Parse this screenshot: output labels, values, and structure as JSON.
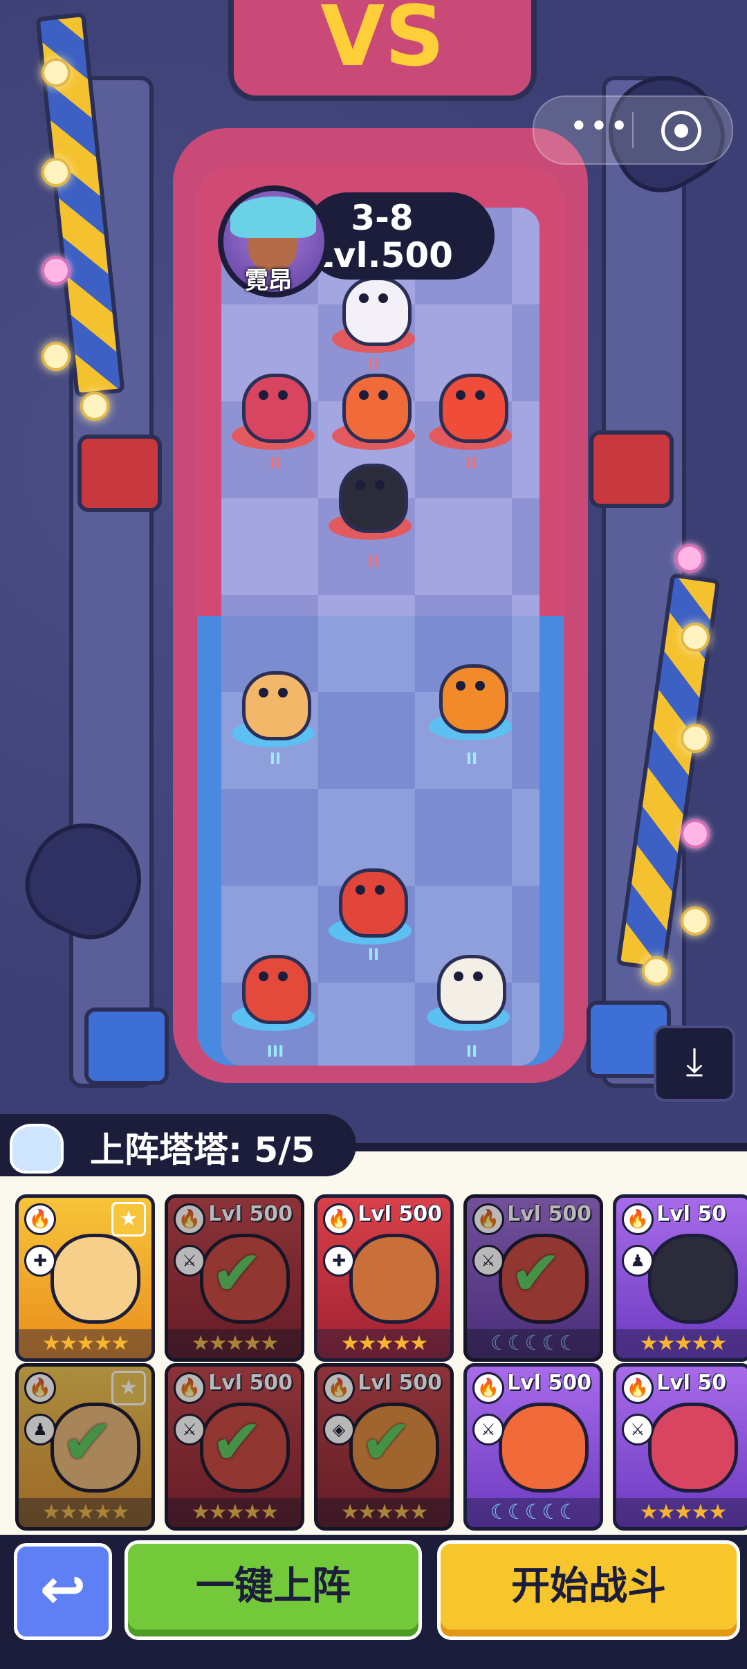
{
  "enemy": {
    "stage": "3-8",
    "level": "Lvl.500",
    "name": "霓昂"
  },
  "top_sign": {
    "text": "VS"
  },
  "enemy_units": [
    {
      "id": "enemy-1",
      "rank": "II",
      "color": "#f3f1f7"
    },
    {
      "id": "enemy-2",
      "rank": "II",
      "color": "#d94561"
    },
    {
      "id": "enemy-3",
      "rank": "II",
      "color": "#f06a3a"
    },
    {
      "id": "enemy-4",
      "rank": "II",
      "color": "#ef4c3a"
    },
    {
      "id": "enemy-5",
      "rank": "II",
      "color": "#2b2b3a"
    }
  ],
  "ally_units": [
    {
      "id": "ally-1",
      "rank": "II",
      "color": "#f3b76a"
    },
    {
      "id": "ally-2",
      "rank": "II",
      "color": "#f08a2a"
    },
    {
      "id": "ally-3",
      "rank": "II",
      "color": "#e2453a"
    },
    {
      "id": "ally-4",
      "rank": "III",
      "color": "#e34a3b"
    },
    {
      "id": "ally-5",
      "rank": "II",
      "color": "#f4efe6"
    }
  ],
  "deploy": {
    "label": "上阵塔塔: 5/5"
  },
  "cards_row1": [
    {
      "theme": "gold",
      "dim": false,
      "lvl": "",
      "check": false,
      "badge": "★",
      "stars": "★★★★★",
      "moons": false,
      "role": "✚",
      "mon": "#f6d08a"
    },
    {
      "theme": "red",
      "dim": true,
      "lvl": "Lvl 500",
      "check": true,
      "badge": "",
      "stars": "★★★★★",
      "moons": false,
      "role": "⚔",
      "mon": "#e2453a"
    },
    {
      "theme": "red",
      "dim": false,
      "lvl": "Lvl 500",
      "check": false,
      "badge": "",
      "stars": "★★★★★",
      "moons": false,
      "role": "✚",
      "mon": "#c9703a"
    },
    {
      "theme": "purple",
      "dim": true,
      "lvl": "Lvl 500",
      "check": true,
      "badge": "",
      "stars": "☾☾☾☾☾",
      "moons": true,
      "role": "⚔",
      "mon": "#e2453a"
    },
    {
      "theme": "purple",
      "dim": false,
      "lvl": "Lvl 50",
      "check": false,
      "badge": "",
      "stars": "★★★★★",
      "moons": false,
      "role": "♟",
      "mon": "#2b2b3a"
    }
  ],
  "cards_row2": [
    {
      "theme": "gold",
      "dim": true,
      "lvl": "",
      "check": true,
      "badge": "★",
      "stars": "★★★★★",
      "moons": false,
      "role": "♟",
      "mon": "#f3b76a"
    },
    {
      "theme": "red",
      "dim": true,
      "lvl": "Lvl 500",
      "check": true,
      "badge": "",
      "stars": "★★★★★",
      "moons": false,
      "role": "⚔",
      "mon": "#e2453a"
    },
    {
      "theme": "red",
      "dim": true,
      "lvl": "Lvl 500",
      "check": true,
      "badge": "",
      "stars": "★★★★★",
      "moons": false,
      "role": "◈",
      "mon": "#f08a2a"
    },
    {
      "theme": "purple",
      "dim": false,
      "lvl": "Lvl 500",
      "check": false,
      "badge": "",
      "stars": "☾☾☾☾☾",
      "moons": true,
      "role": "⚔",
      "mon": "#f06a3a"
    },
    {
      "theme": "purple",
      "dim": false,
      "lvl": "Lvl 50",
      "check": false,
      "badge": "",
      "stars": "★★★★★",
      "moons": false,
      "role": "⚔",
      "mon": "#d94561"
    }
  ],
  "buttons": {
    "back": "↩",
    "auto_deploy": "一键上阵",
    "start_battle": "开始战斗",
    "side": "⤓"
  },
  "capsule": {
    "dots": "•••"
  }
}
